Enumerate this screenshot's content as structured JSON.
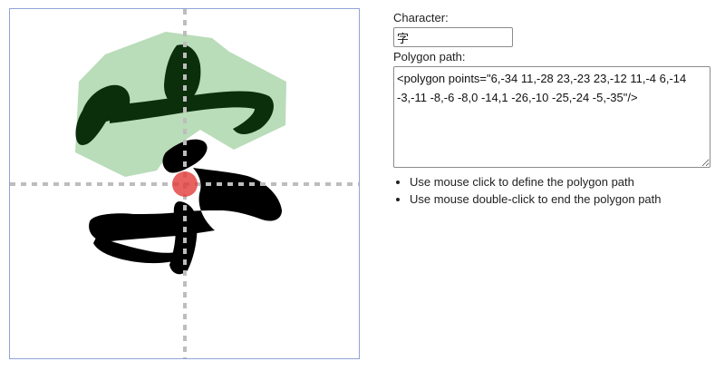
{
  "canvas": {
    "glyph": "字",
    "colors": {
      "border": "#8fa4d8",
      "guide": "#bdbdbd",
      "polygon_fill": "#b9dcb9",
      "stroke_dark": "#0b2e0b",
      "stroke_black": "#000000",
      "marker": "#e23b3b"
    }
  },
  "form": {
    "character_label": "Character:",
    "character_value": "字",
    "path_label": "Polygon path:",
    "path_value": "<polygon points=\"6,-34 11,-28 23,-23 23,-12 11,-4 6,-14 -3,-11 -8,-6 -8,0 -14,1 -26,-10 -25,-24 -5,-35\"/>"
  },
  "hints": [
    "Use mouse click to define the polygon path",
    "Use mouse double-click to end the polygon path"
  ]
}
